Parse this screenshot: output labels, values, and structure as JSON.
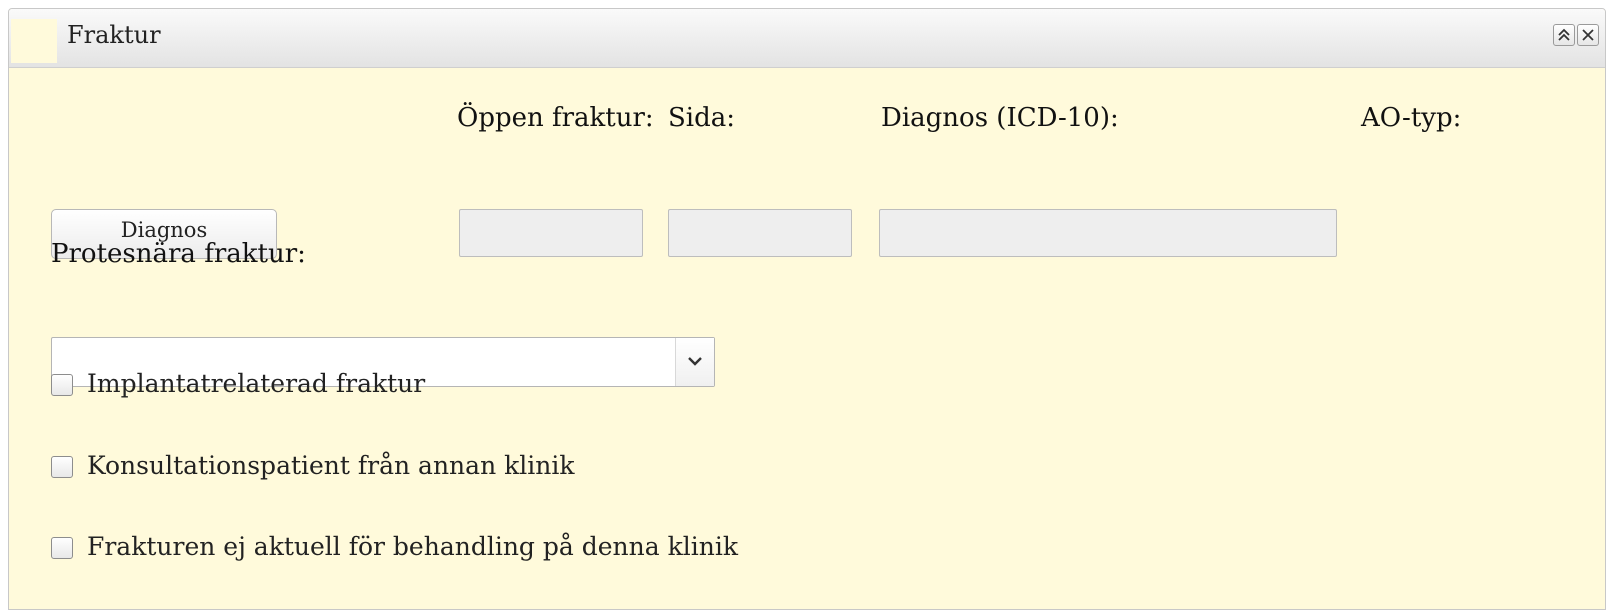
{
  "panel": {
    "title": "Fraktur",
    "collapse_icon": "double-chevron-up-icon",
    "close_icon": "close-icon"
  },
  "form": {
    "diagnos_button": "Diagnos",
    "open_fracture_label": "Öppen fraktur:",
    "side_label": "Sida:",
    "diagnosis_label": "Diagnos (ICD-10):",
    "ao_type_label": "AO-typ:",
    "open_fracture_value": "",
    "side_value": "",
    "diagnosis_value": "",
    "prosthesis_label": "Protesnära fraktur:",
    "prosthesis_value": "",
    "checkboxes": [
      {
        "label": "Implantatrelaterad fraktur",
        "checked": false
      },
      {
        "label": "Konsultationspatient från annan klinik",
        "checked": false
      },
      {
        "label": "Frakturen ej aktuell för behandling på denna klinik",
        "checked": false
      }
    ]
  },
  "colors": {
    "panel_background": "#fffadb",
    "header_gradient_top": "#fafafa",
    "header_gradient_bottom": "#e3e3e3",
    "readonly_field": "#eeeeee"
  }
}
